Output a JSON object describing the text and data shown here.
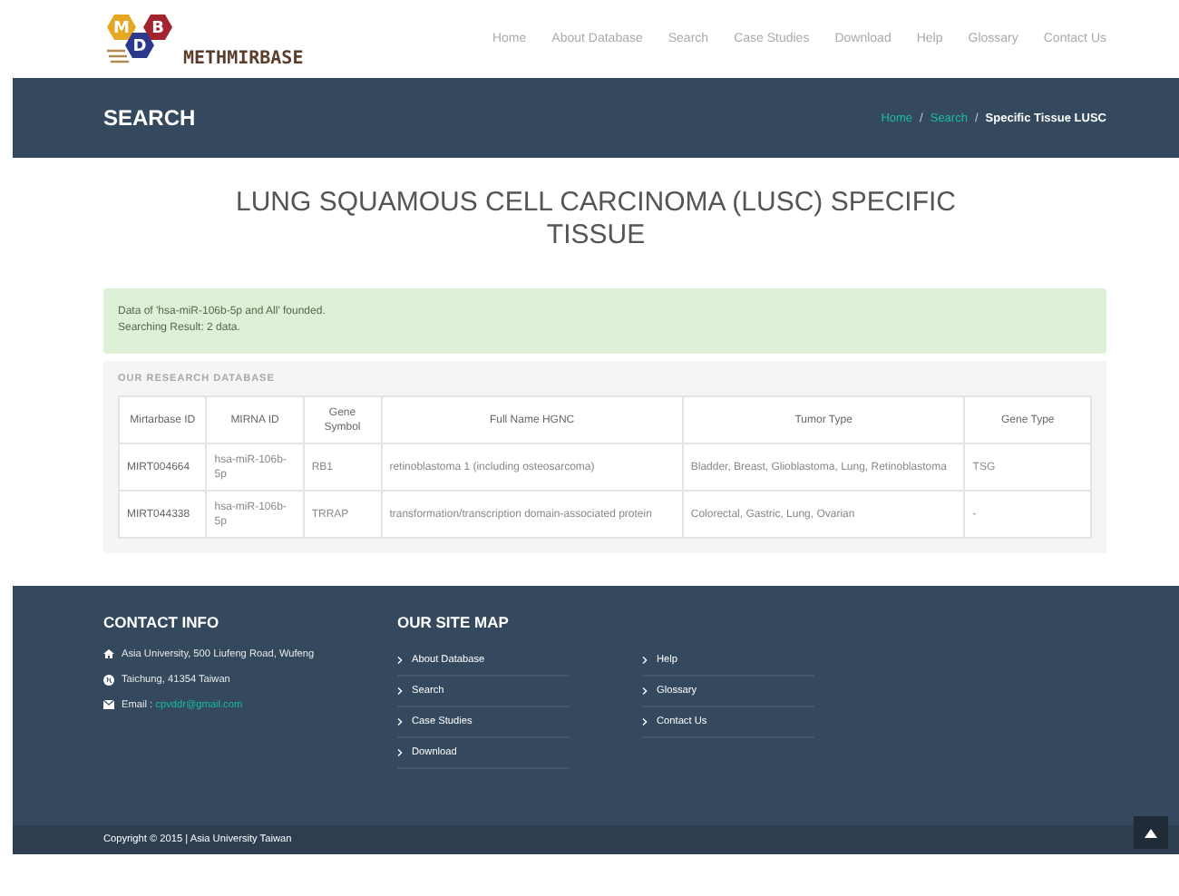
{
  "logo": {
    "letters": [
      "M",
      "B",
      "D"
    ],
    "name": "METHMIRBASE"
  },
  "nav": [
    {
      "label": "Home",
      "selected": false
    },
    {
      "label": "About Database",
      "selected": false
    },
    {
      "label": "Search",
      "selected": false
    },
    {
      "label": "Case Studies",
      "selected": false
    },
    {
      "label": "Download",
      "selected": false
    },
    {
      "label": "Help",
      "selected": false
    },
    {
      "label": "Glossary",
      "selected": false
    },
    {
      "label": "Contact Us",
      "selected": false
    }
  ],
  "page_title": "SEARCH",
  "breadcrumb": [
    {
      "label": "Home",
      "kind": "link"
    },
    {
      "separator": "/",
      "label": "Search",
      "kind": "link"
    },
    {
      "separator": "/",
      "label": "Specific Tissue LUSC",
      "kind": "current"
    }
  ],
  "heading": "LUNG SQUAMOUS CELL CARCINOMA (LUSC) SPECIFIC TISSUE",
  "alert": [
    "Data of 'hsa-miR-106b-5p and All' founded.",
    "Searching Result: 2 data."
  ],
  "table": {
    "caption": "OUR RESEARCH DATABASE",
    "columns": [
      "Mirtarbase ID",
      "MIRNA ID",
      "Gene Symbol",
      "Full Name HGNC",
      "Tumor Type",
      "Gene Type"
    ],
    "rows": [
      [
        "MIRT004664",
        "hsa-miR-106b-5p",
        "RB1",
        "retinoblastoma 1 (including osteosarcoma)",
        "Bladder, Breast, Glioblastoma, Lung, Retinoblastoma",
        "TSG"
      ],
      [
        "MIRT044338",
        "hsa-miR-106b-5p",
        "TRRAP",
        "transformation/transcription domain-associated protein",
        "Colorectal, Gastric, Lung, Ovarian",
        "-"
      ]
    ]
  },
  "contact": {
    "title": "CONTACT INFO",
    "items": [
      {
        "kind": "home",
        "text": "Asia University, 500 Liufeng Road, Wufeng"
      },
      {
        "kind": "globe",
        "text": "Taichung, 41354 Taiwan"
      },
      {
        "kind": "mail",
        "text": "Email : ",
        "link": "cpvddr@gmail.com"
      }
    ]
  },
  "sitemap": {
    "title": "OUR SITE MAP",
    "columns": [
      [
        "About Database",
        "Search",
        "Case Studies",
        "Download"
      ],
      [
        "Help",
        "Glossary",
        "Contact Us"
      ]
    ]
  },
  "copyright": "Copyright © 2015 | Asia University Taiwan"
}
